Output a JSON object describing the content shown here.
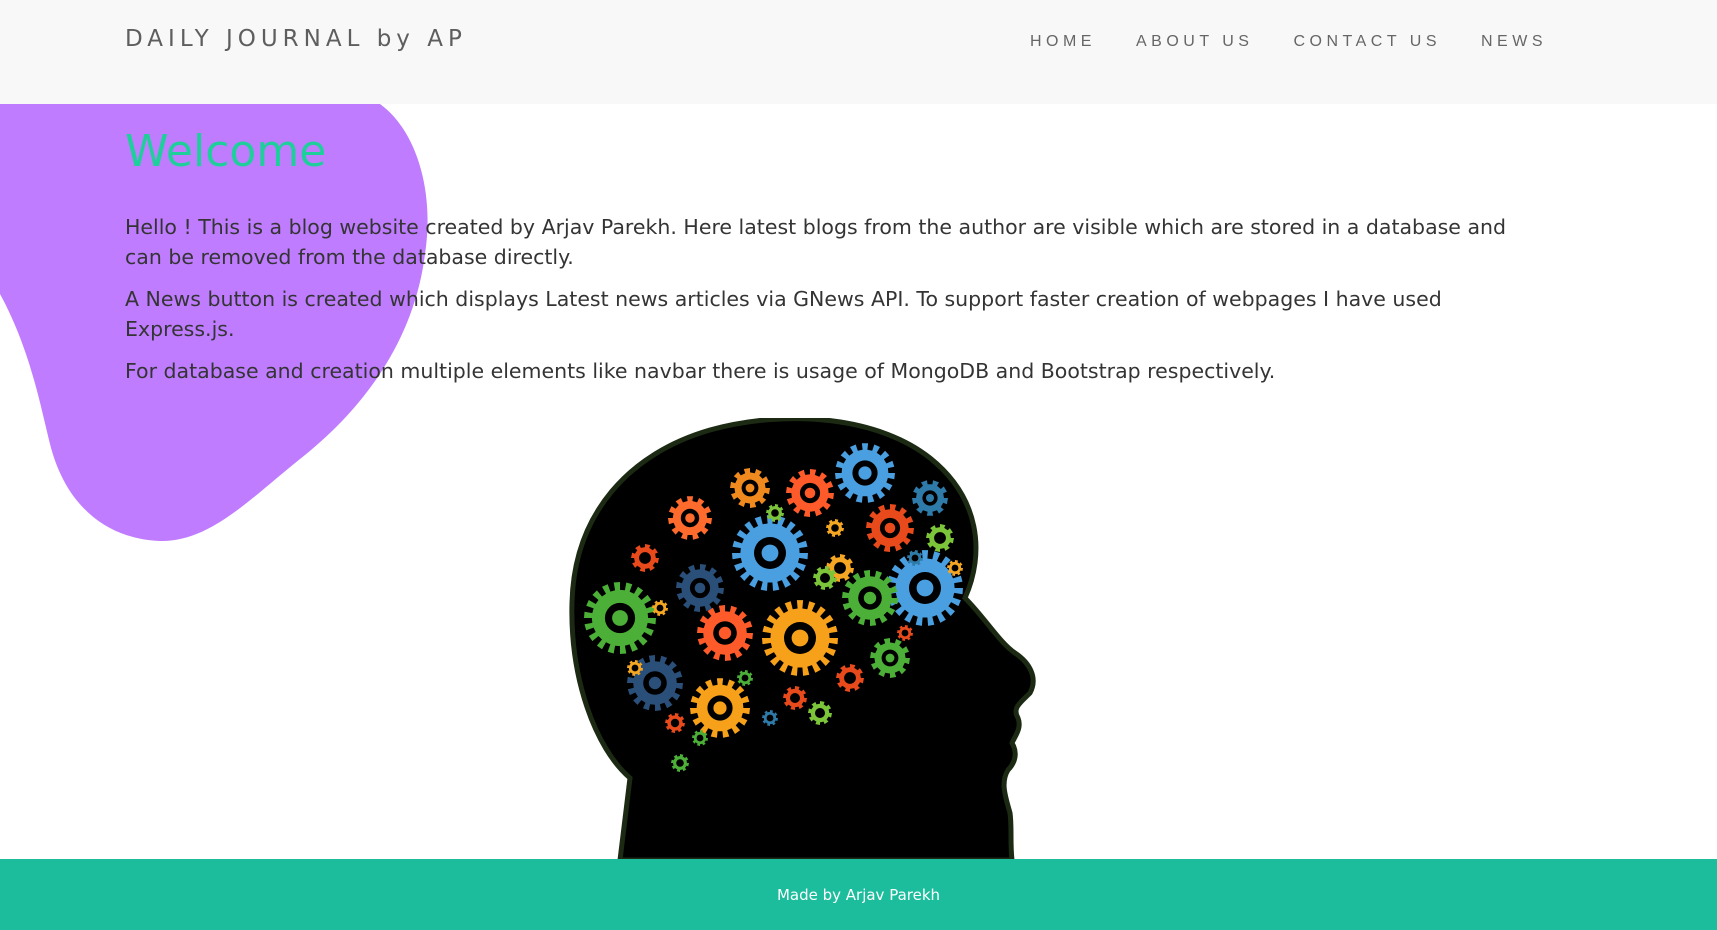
{
  "navbar": {
    "brand": "DAILY JOURNAL by AP",
    "links": [
      {
        "label": "HOME"
      },
      {
        "label": "ABOUT US"
      },
      {
        "label": "CONTACT US"
      },
      {
        "label": "NEWS"
      }
    ]
  },
  "main": {
    "heading": "Welcome",
    "paragraphs": [
      "Hello ! This is a blog website created by Arjav Parekh. Here latest blogs from the author are visible which are stored in a database and can be removed from the database directly.",
      "A News button is created which displays Latest news articles via GNews API. To support faster creation of webpages I have used Express.js.",
      "For database and creation multiple elements like navbar there is usage of MongoDB and Bootstrap respectively."
    ],
    "illustration_icon": "head-with-gears-icon"
  },
  "footer": {
    "text": "Made by Arjav Parekh"
  },
  "colors": {
    "navbar_bg": "#f8f8f8",
    "heading": "#1fcf9b",
    "blob": "#c07cff",
    "footer_bg": "#1bbd9c",
    "body_text": "#343434"
  }
}
